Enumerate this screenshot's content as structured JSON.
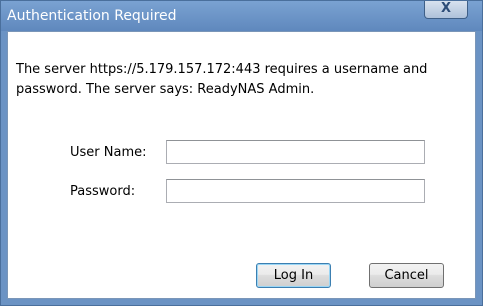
{
  "dialog": {
    "title": "Authentication Required",
    "close_label": "X",
    "message": "The server https://5.179.157.172:443 requires a username and password. The server says: ReadyNAS Admin.",
    "username_label": "User Name:",
    "username_value": "",
    "password_label": "Password:",
    "password_value": "",
    "login_label": "Log In",
    "cancel_label": "Cancel"
  }
}
